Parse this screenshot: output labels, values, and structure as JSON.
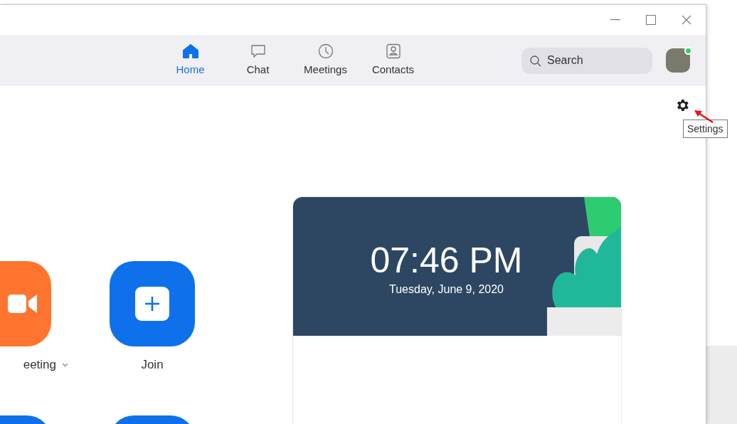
{
  "tabs": [
    {
      "label": "Home",
      "kind": "home",
      "selected": true
    },
    {
      "label": "Chat",
      "kind": "chat",
      "selected": false
    },
    {
      "label": "Meetings",
      "kind": "clock",
      "selected": false
    },
    {
      "label": "Contacts",
      "kind": "contact",
      "selected": false
    }
  ],
  "search": {
    "placeholder": "Search"
  },
  "avatar": {
    "online": true
  },
  "settings_tooltip": "Settings",
  "tiles": [
    {
      "kind": "video",
      "label": "eeting",
      "color": "#ff742e",
      "dropdown": true
    },
    {
      "kind": "join",
      "label": "Join",
      "color": "#0e71eb",
      "dropdown": false
    },
    {
      "kind": "blank",
      "color": "#0e71eb"
    },
    {
      "kind": "blank",
      "color": "#0e71eb"
    }
  ],
  "clock": {
    "time": "07:46 PM",
    "date": "Tuesday, June 9, 2020"
  }
}
